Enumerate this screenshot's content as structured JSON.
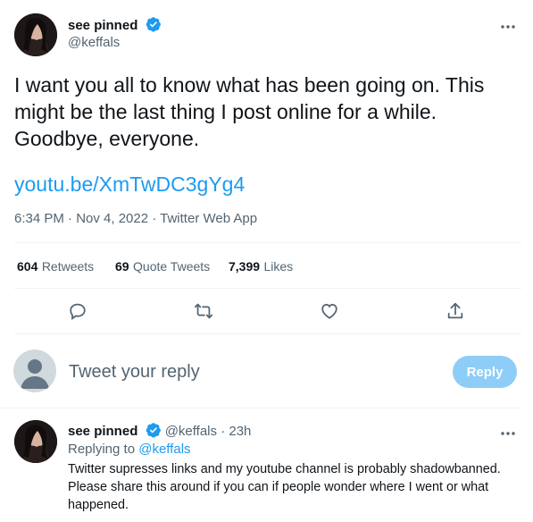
{
  "tweet": {
    "display_name": "see pinned",
    "handle": "@keffals",
    "more_icon": "more-horizontal-icon",
    "text_line1": "I want you all to know what has been going on. This",
    "text_line2": "might be the last thing I post online for a while.",
    "text_line3": "Goodbye, everyone.",
    "link": "youtu.be/XmTwDC3gYg4",
    "meta": "6:34 PM · Nov 4, 2022 · Twitter Web App",
    "retweets_count": "604",
    "retweets_label": "Retweets",
    "quotes_count": "69",
    "quotes_label": "Quote Tweets",
    "likes_count": "7,399",
    "likes_label": "Likes",
    "actions": [
      "reply-icon",
      "retweet-icon",
      "like-icon",
      "share-icon"
    ]
  },
  "composer": {
    "placeholder": "Tweet your reply",
    "reply_button": "Reply"
  },
  "reply": {
    "display_name": "see pinned",
    "handle": "@keffals",
    "time": "· 23h",
    "replying_prefix": "Replying to",
    "replying_to": "@keffals",
    "text_line1": "Twitter supresses links and my youtube channel is probably shadowbanned.",
    "text_line2": "Please share this around if you can if people wonder where I went or what",
    "text_line3": "happened."
  },
  "colors": {
    "accent": "#1d9bf0",
    "reply_button_disabled": "#8ecdf8",
    "muted": "#536471"
  }
}
